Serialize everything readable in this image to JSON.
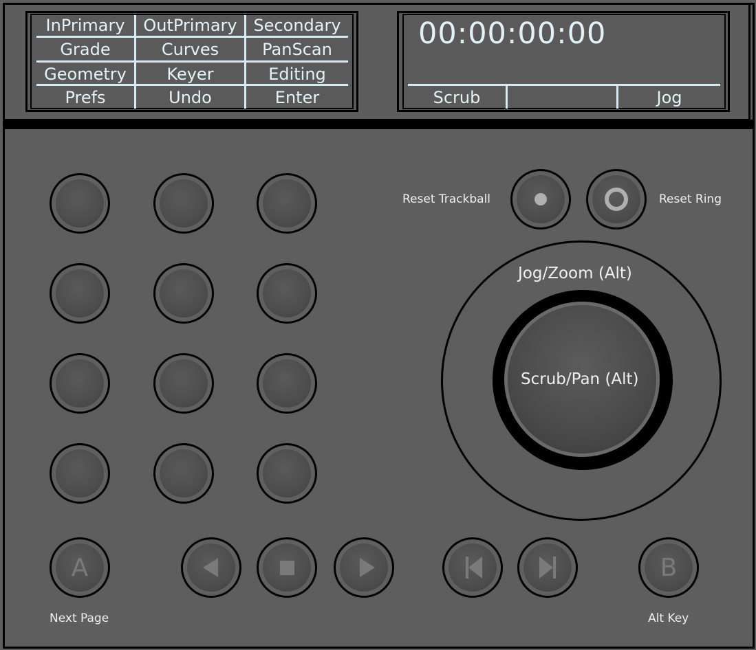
{
  "menu": {
    "rows": [
      [
        "InPrimary",
        "OutPrimary",
        "Secondary"
      ],
      [
        "Grade",
        "Curves",
        "PanScan"
      ],
      [
        "Geometry",
        "Keyer",
        "Editing"
      ],
      [
        "Prefs",
        "Undo",
        "Enter"
      ]
    ]
  },
  "display": {
    "timecode": "00:00:00:00",
    "soft_left": "Scrub",
    "soft_middle": "",
    "soft_right": "Jog"
  },
  "reset": {
    "trackball_label": "Reset Trackball",
    "ring_label": "Reset Ring"
  },
  "jog": {
    "outer_label": "Jog/Zoom (Alt)",
    "inner_label": "Scrub/Pan (Alt)"
  },
  "bottom": {
    "a_letter": "A",
    "b_letter": "B",
    "next_page_label": "Next Page",
    "alt_key_label": "Alt Key"
  },
  "icons": {
    "reverse": "play-reverse-icon",
    "stop": "stop-icon",
    "play": "play-icon",
    "prev": "skip-previous-icon",
    "next": "skip-next-icon"
  },
  "colors": {
    "panel": "#5e5e5e",
    "lcd_text": "#e4f2f8",
    "button_glyph": "#7a7a7a"
  }
}
